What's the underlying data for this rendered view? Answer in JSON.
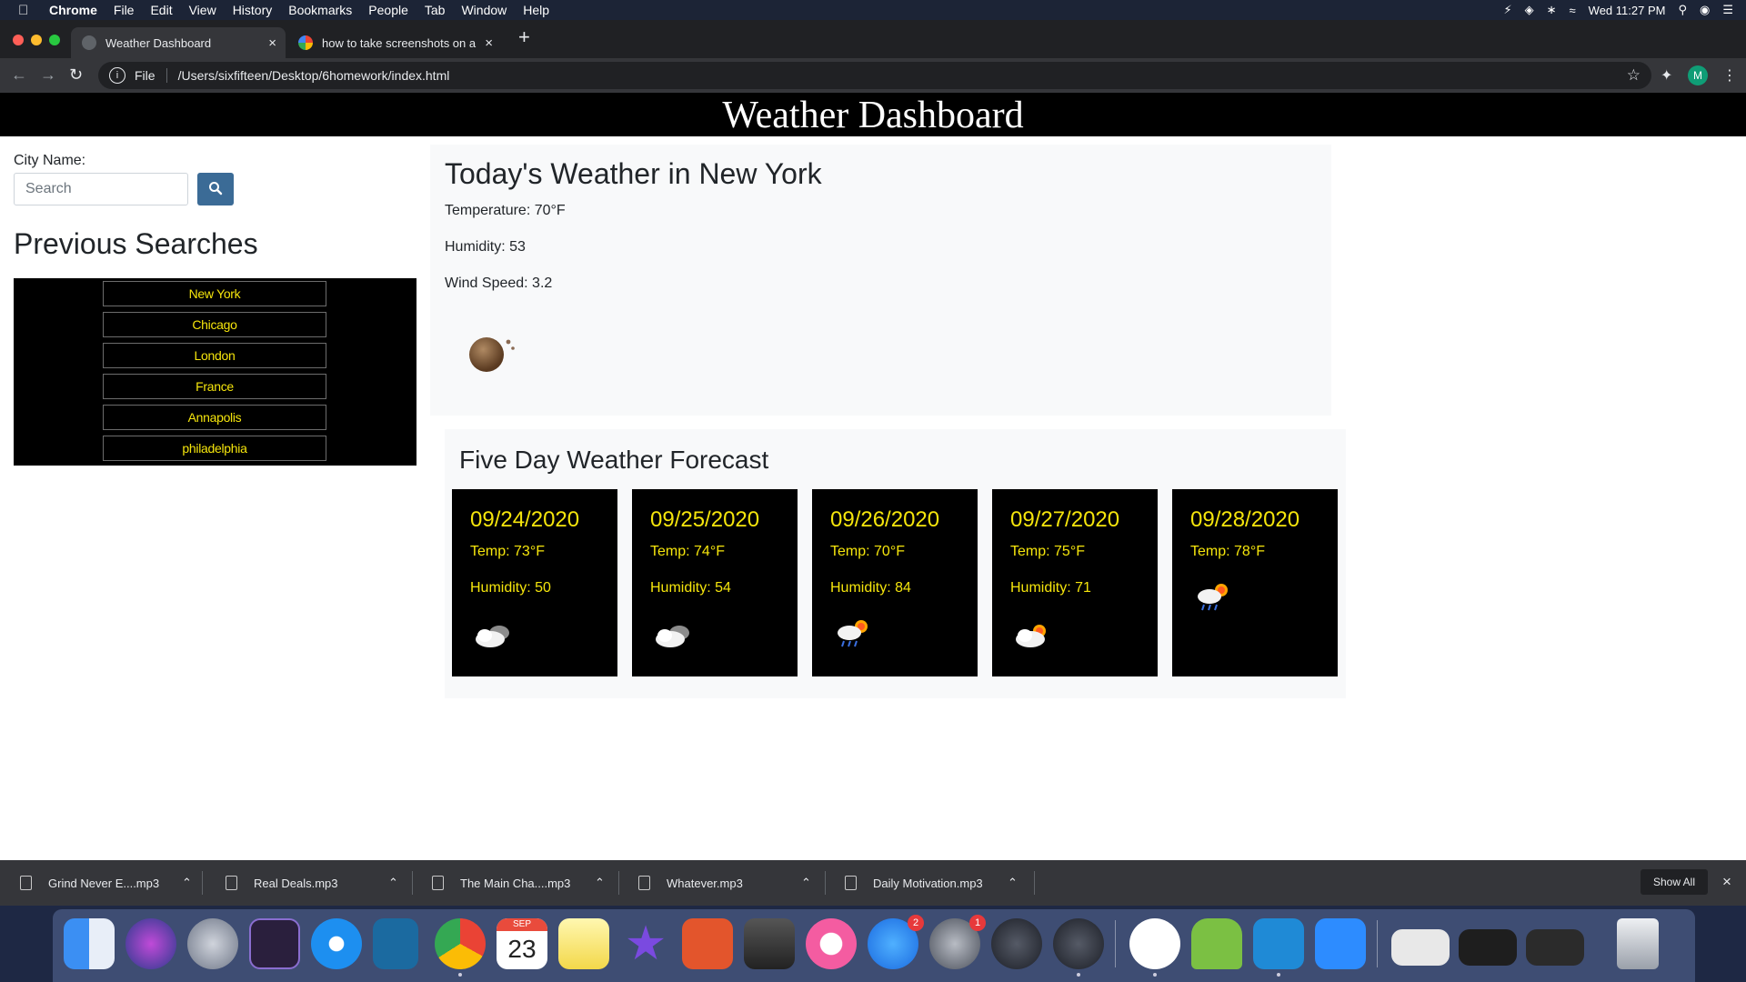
{
  "menubar": {
    "app_name": "Chrome",
    "menus": [
      "File",
      "Edit",
      "View",
      "History",
      "Bookmarks",
      "People",
      "Tab",
      "Window",
      "Help"
    ],
    "clock": "Wed 11:27 PM"
  },
  "tabs": [
    {
      "title": "Weather Dashboard",
      "close": "×"
    },
    {
      "title": "how to take screenshots on a r",
      "close": "×"
    }
  ],
  "new_tab": "+",
  "address": {
    "scheme": "File",
    "url": "/Users/sixfifteen/Desktop/6homework/index.html",
    "profile_initial": "M"
  },
  "page": {
    "header_title": "Weather Dashboard",
    "city_label": "City Name:",
    "search_placeholder": "Search",
    "previous_title": "Previous Searches",
    "previous_searches": [
      "New York",
      "Chicago",
      "London",
      "France",
      "Annapolis",
      "philadelphia"
    ],
    "today": {
      "title": "Today's Weather in New York",
      "temperature": "Temperature: 70°F",
      "humidity": "Humidity: 53",
      "wind": "Wind Speed: 3.2"
    },
    "forecast": {
      "title": "Five Day Weather Forecast",
      "days": [
        {
          "date": "09/24/2020",
          "temp": "Temp: 73°F",
          "humidity": "Humidity: 50",
          "icon": "cloudy-icon"
        },
        {
          "date": "09/25/2020",
          "temp": "Temp: 74°F",
          "humidity": "Humidity: 54",
          "icon": "cloudy-icon"
        },
        {
          "date": "09/26/2020",
          "temp": "Temp: 70°F",
          "humidity": "Humidity: 84",
          "icon": "rain-sun-icon"
        },
        {
          "date": "09/27/2020",
          "temp": "Temp: 75°F",
          "humidity": "Humidity: 71",
          "icon": "partly-cloudy-icon"
        },
        {
          "date": "09/28/2020",
          "temp": "Temp: 78°F",
          "humidity": "",
          "icon": "rain-sun-icon"
        }
      ]
    }
  },
  "downloads": {
    "items": [
      "Grind Never E....mp3",
      "Real Deals.mp3",
      "The Main Cha....mp3",
      "Whatever.mp3",
      "Daily Motivation.mp3"
    ],
    "show_all": "Show All",
    "close": "×"
  },
  "dock": {
    "calendar_month": "SEP",
    "calendar_day": "23",
    "appstore_badge": "2",
    "settings_badge": "1"
  },
  "colors": {
    "forecast_text": "#f5e50c",
    "search_button": "#3b6b96",
    "menubar": "#1c2436"
  }
}
